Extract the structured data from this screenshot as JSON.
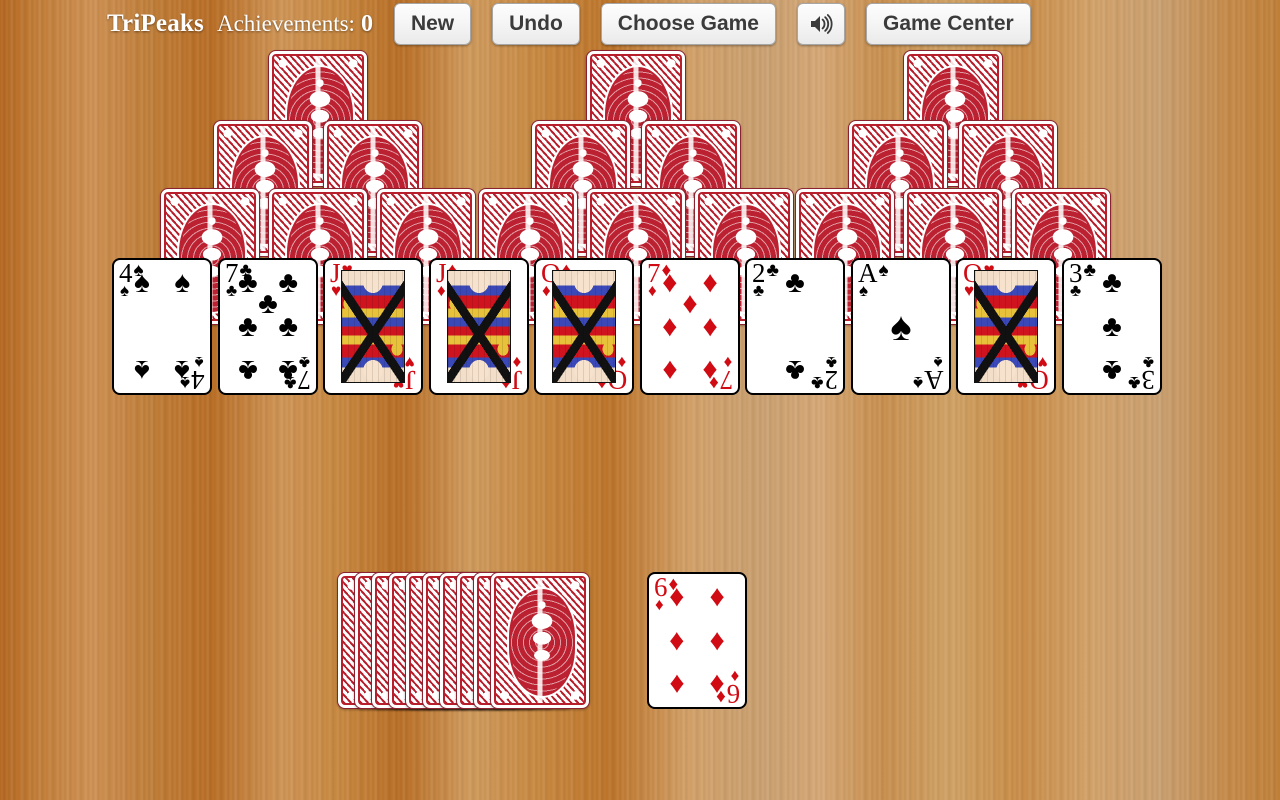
{
  "app": {
    "title": "TriPeaks",
    "achievements_label": "Achievements:",
    "achievements_value": "0"
  },
  "toolbar": {
    "new_label": "New",
    "undo_label": "Undo",
    "choose_game_label": "Choose Game",
    "sound_icon": "speaker-on-icon",
    "game_center_label": "Game Center"
  },
  "colors": {
    "table": "#cd8a47",
    "card_back_red": "#b81f2d",
    "red_suit": "#d00b14",
    "black_suit": "#000000",
    "title_text": "#ffffff",
    "button_text": "#3b3b3b"
  },
  "tableau": {
    "row1_facedown_count": 3,
    "row2_facedown_count": 6,
    "row3_facedown_count": 9,
    "row4_faceup": [
      {
        "rank": "4",
        "suit": "spades",
        "glyph": "♠",
        "color": "black",
        "layout": "4"
      },
      {
        "rank": "7",
        "suit": "clubs",
        "glyph": "♣",
        "color": "black",
        "layout": "7"
      },
      {
        "rank": "J",
        "suit": "hearts",
        "glyph": "♥",
        "color": "red",
        "layout": "court"
      },
      {
        "rank": "J",
        "suit": "diamonds",
        "glyph": "♦",
        "color": "red",
        "layout": "court"
      },
      {
        "rank": "Q",
        "suit": "diamonds",
        "glyph": "♦",
        "color": "red",
        "layout": "court"
      },
      {
        "rank": "7",
        "suit": "diamonds",
        "glyph": "♦",
        "color": "red",
        "layout": "7"
      },
      {
        "rank": "2",
        "suit": "clubs",
        "glyph": "♣",
        "color": "black",
        "layout": "2"
      },
      {
        "rank": "A",
        "suit": "spades",
        "glyph": "♠",
        "color": "black",
        "layout": "A"
      },
      {
        "rank": "Q",
        "suit": "hearts",
        "glyph": "♥",
        "color": "red",
        "layout": "court"
      },
      {
        "rank": "3",
        "suit": "clubs",
        "glyph": "♣",
        "color": "black",
        "layout": "3"
      }
    ]
  },
  "stock": {
    "facedown_count": 10
  },
  "waste": {
    "top_card": {
      "rank": "6",
      "suit": "diamonds",
      "glyph": "♦",
      "color": "red",
      "layout": "6"
    }
  }
}
